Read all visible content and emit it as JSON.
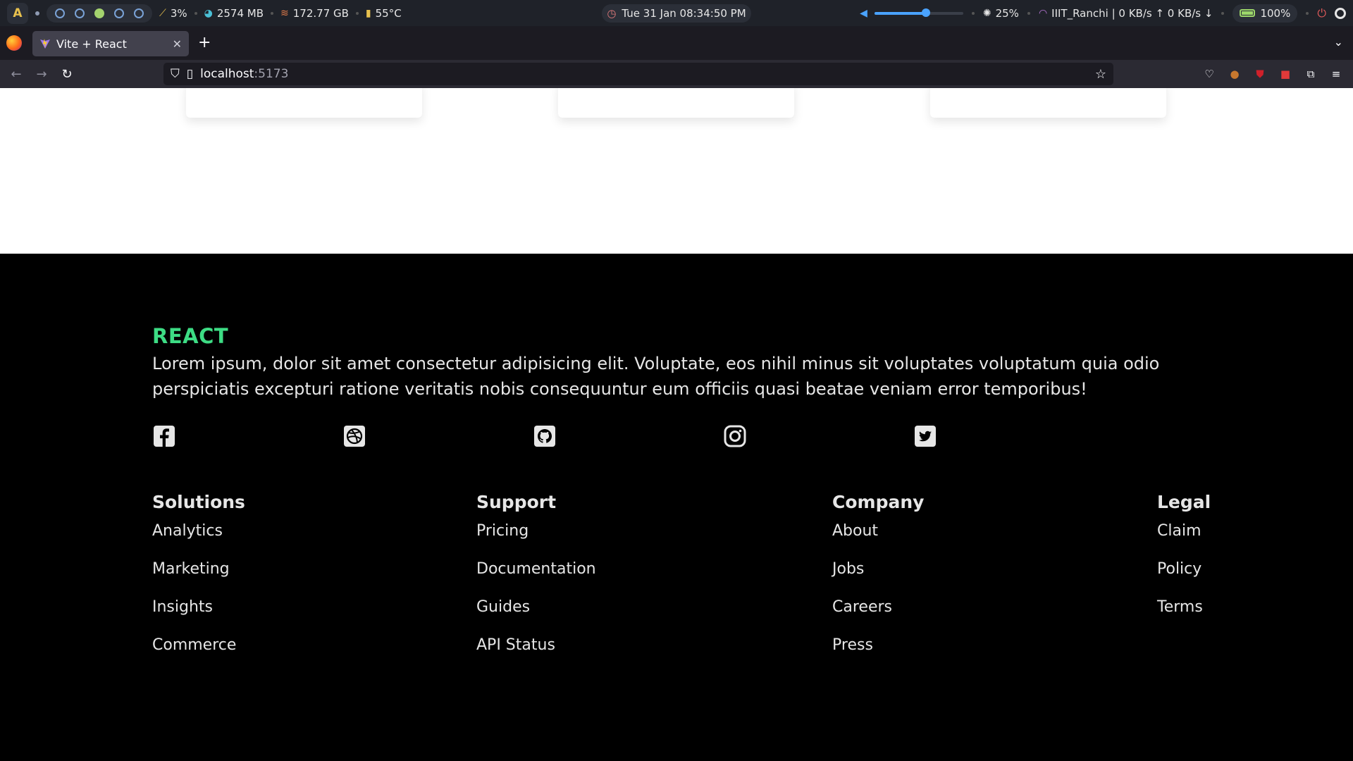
{
  "system_bar": {
    "cpu": "3%",
    "memory": "2574 MB",
    "disk": "172.77 GB",
    "temperature": "55°C",
    "datetime": "Tue 31 Jan 08:34:50 PM",
    "volume_level": 0.58,
    "brightness": "25%",
    "network": "IIIT_Ranchi | 0 KB/s ↑ 0 KB/s ↓",
    "battery": "100%"
  },
  "browser": {
    "tab_title": "Vite + React",
    "url_host": "localhost",
    "url_port": ":5173"
  },
  "footer": {
    "brand": "REACT",
    "description": "Lorem ipsum, dolor sit amet consectetur adipisicing elit. Voluptate, eos nihil minus sit voluptates voluptatum quia odio perspiciatis excepturi ratione veritatis nobis consequuntur eum officiis quasi beatae veniam error temporibus!",
    "social_icons": [
      "facebook-icon",
      "dribbble-icon",
      "github-icon",
      "instagram-icon",
      "twitter-icon"
    ],
    "columns": [
      {
        "heading": "Solutions",
        "links": [
          "Analytics",
          "Marketing",
          "Insights",
          "Commerce"
        ]
      },
      {
        "heading": "Support",
        "links": [
          "Pricing",
          "Documentation",
          "Guides",
          "API Status"
        ]
      },
      {
        "heading": "Company",
        "links": [
          "About",
          "Jobs",
          "Careers",
          "Press"
        ]
      },
      {
        "heading": "Legal",
        "links": [
          "Claim",
          "Policy",
          "Terms"
        ]
      }
    ]
  },
  "colors": {
    "brand_green": "#3ddc84",
    "footer_bg": "#000000",
    "accent_blue": "#4aa3ff"
  }
}
